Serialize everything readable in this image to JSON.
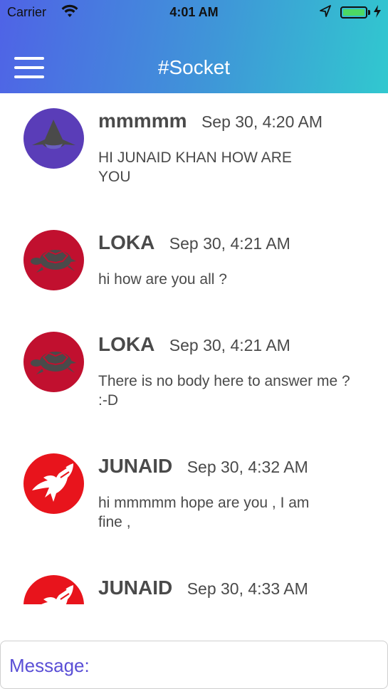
{
  "status_bar": {
    "carrier": "Carrier",
    "time": "4:01 AM",
    "wifi_icon": "wifi-icon",
    "location_icon": "location-arrow-icon",
    "battery_level": 1.0,
    "charging_icon": "bolt-icon"
  },
  "header": {
    "title": "#Socket",
    "menu_icon": "hamburger-menu-icon",
    "gradient": [
      "#4f63e6",
      "#31c8cf"
    ]
  },
  "messages": [
    {
      "sender": "mmmmm",
      "timestamp": "Sep 30, 4:20 AM",
      "text": "HI JUNAID KHAN HOW ARE YOU",
      "avatar": "shark-avatar",
      "avatar_color": "#5a3db8"
    },
    {
      "sender": "LOKA",
      "timestamp": "Sep 30, 4:21 AM",
      "text": "hi how are you all ?",
      "avatar": "turtle-avatar",
      "avatar_color": "#c1102f"
    },
    {
      "sender": "LOKA",
      "timestamp": "Sep 30, 4:21 AM",
      "text": "There is no body here to answer me ? :-D",
      "avatar": "turtle-avatar",
      "avatar_color": "#c1102f"
    },
    {
      "sender": "JUNAID",
      "timestamp": "Sep 30, 4:32 AM",
      "text": "hi mmmmm hope are you , I am fine ,",
      "avatar": "eagle-avatar",
      "avatar_color": "#e8141c"
    },
    {
      "sender": "JUNAID",
      "timestamp": "Sep 30, 4:33 AM",
      "text": "",
      "avatar": "eagle-avatar",
      "avatar_color": "#e8141c"
    }
  ],
  "composer": {
    "placeholder": "Message:",
    "value": ""
  }
}
